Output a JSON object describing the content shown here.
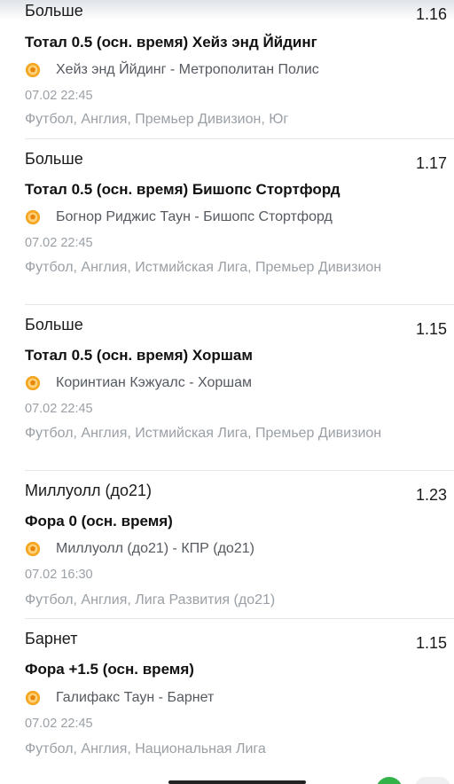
{
  "bets": [
    {
      "outcome": "Больше",
      "odds": "1.16",
      "market": "Тотал 0.5 (осн. время)  Хейз энд Ййдинг",
      "match": "Хейз энд Ййдинг - Метрополитан Полис",
      "datetime": "07.02 22:45",
      "league": "Футбол, Англия, Премьер Дивизион, Юг"
    },
    {
      "outcome": "Больше",
      "odds": "1.17",
      "market": "Тотал 0.5 (осн. время)  Бишопс Стортфорд",
      "match": "Богнор Риджис Таун - Бишопс Стортфорд",
      "datetime": "07.02 22:45",
      "league": "Футбол, Англия, Истмийская Лига, Премьер Дивизион"
    },
    {
      "outcome": "Больше",
      "odds": "1.15",
      "market": "Тотал 0.5 (осн. время)  Хоршам",
      "match": "Коринтиан Кэжуалс - Хоршам",
      "datetime": "07.02 22:45",
      "league": "Футбол, Англия, Истмийская Лига, Премьер Дивизион"
    },
    {
      "outcome": "Миллуолл (до21)",
      "odds": "1.23",
      "market": "Фора 0 (осн. время)",
      "match": "Миллуолл (до21) - КПР (до21)",
      "datetime": "07.02 16:30",
      "league": "Футбол, Англия, Лига Развития (до21)"
    },
    {
      "outcome": "Барнет",
      "odds": "1.15",
      "market": "Фора +1.5 (осн. время)",
      "match": "Галифакс Таун - Барнет",
      "datetime": "07.02 22:45",
      "league": "Футбол, Англия, Национальная Лига"
    }
  ],
  "icons": {
    "sport": "football-icon"
  },
  "colors": {
    "ball_orange": "#f5a623",
    "secondary_text": "#9aa0a6",
    "fab_green": "#33b24a"
  }
}
